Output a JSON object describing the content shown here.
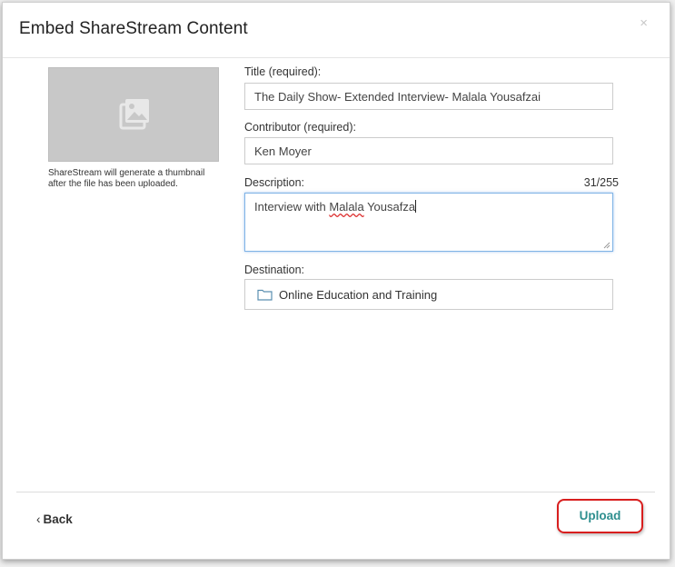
{
  "dialog": {
    "title": "Embed ShareStream Content",
    "close_symbol": "×"
  },
  "thumbnail": {
    "icon": "image-gallery-icon",
    "note": "ShareStream will generate a thumbnail after the file has been uploaded."
  },
  "form": {
    "title_label": "Title (required):",
    "title_value": "The Daily Show- Extended Interview- Malala Yousafzai",
    "contributor_label": "Contributor (required):",
    "contributor_value": "Ken Moyer",
    "description_label": "Description:",
    "description_count": "31/255",
    "description_prefix": "Interview with ",
    "description_misspelled_1": "Malala",
    "description_space": " ",
    "description_misspelled_2": "Yousafza",
    "destination_label": "Destination:",
    "destination_value": "Online Education and Training",
    "destination_icon": "folder-icon"
  },
  "footer": {
    "back_chevron": "‹",
    "back_label": "Back",
    "upload_label": "Upload"
  },
  "colors": {
    "upload_text": "#2f8f8f",
    "highlight_border": "#d81e1e",
    "focus_border": "#7fb3e6"
  }
}
